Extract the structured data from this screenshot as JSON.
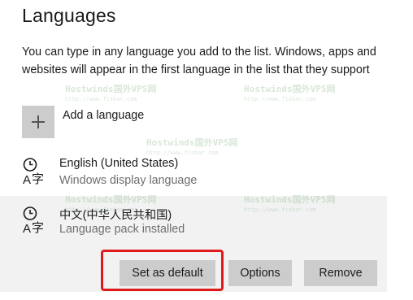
{
  "header": {
    "title": "Languages"
  },
  "description": "You can type in any language you add to the list. Windows, apps and websites will appear in the first language in the list that they support",
  "add_language": {
    "label": "Add a language"
  },
  "languages": [
    {
      "name": "English (United States)",
      "subtitle": "Windows display language"
    },
    {
      "name": "中文(中华人民共和国)",
      "subtitle": "Language pack installed"
    }
  ],
  "actions": {
    "set_default": "Set as default",
    "options": "Options",
    "remove": "Remove"
  },
  "watermark": {
    "brand": "Hostwinds国外VPS网",
    "url": "http://www.fisbar.com"
  },
  "colors": {
    "highlight_border": "#e01a1a",
    "button_bg": "#cccccc",
    "selected_row_bg": "#f2f2f2",
    "secondary_text": "#6e6e6e"
  }
}
